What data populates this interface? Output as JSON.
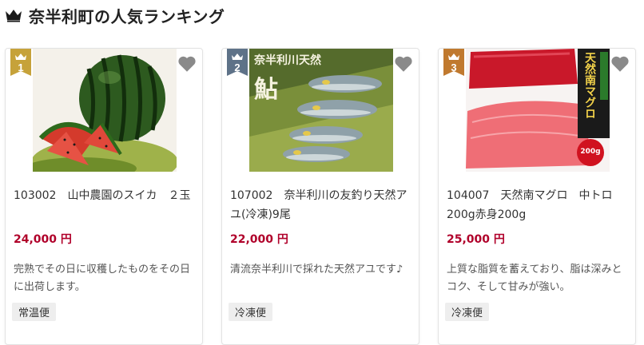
{
  "section_title": "奈半利町の人気ランキング",
  "colors": {
    "gold": "#c6a23a",
    "slate": "#5e7288",
    "bronze": "#c0792e",
    "price": "#b0002a"
  },
  "products": [
    {
      "rank": "1",
      "rank_color": "gold",
      "image_icon": "watermelon-photo",
      "name": "103002　山中農園のスイカ　２玉",
      "price": "24,000 円",
      "description": "完熟でその日に収穫したものをその日に出荷します。",
      "tag": "常温便"
    },
    {
      "rank": "2",
      "rank_color": "slate",
      "image_icon": "ayu-fish-photo",
      "image_text": "奈半利川天然",
      "image_text_big": "鮎",
      "name": "107002　奈半利川の友釣り天然アユ(冷凍)9尾",
      "price": "22,000 円",
      "description": "清流奈半利川で採れた天然アユです♪",
      "tag": "冷凍便"
    },
    {
      "rank": "3",
      "rank_color": "bronze",
      "image_icon": "tuna-photo",
      "image_text": "天然南マグロ",
      "image_badge": "200g",
      "name": "104007　天然南マグロ　中トロ200g赤身200g",
      "price": "25,000 円",
      "description": "上質な脂質を蓄えており、脂は深みとコク、そして甘みが強い。",
      "tag": "冷凍便"
    }
  ]
}
